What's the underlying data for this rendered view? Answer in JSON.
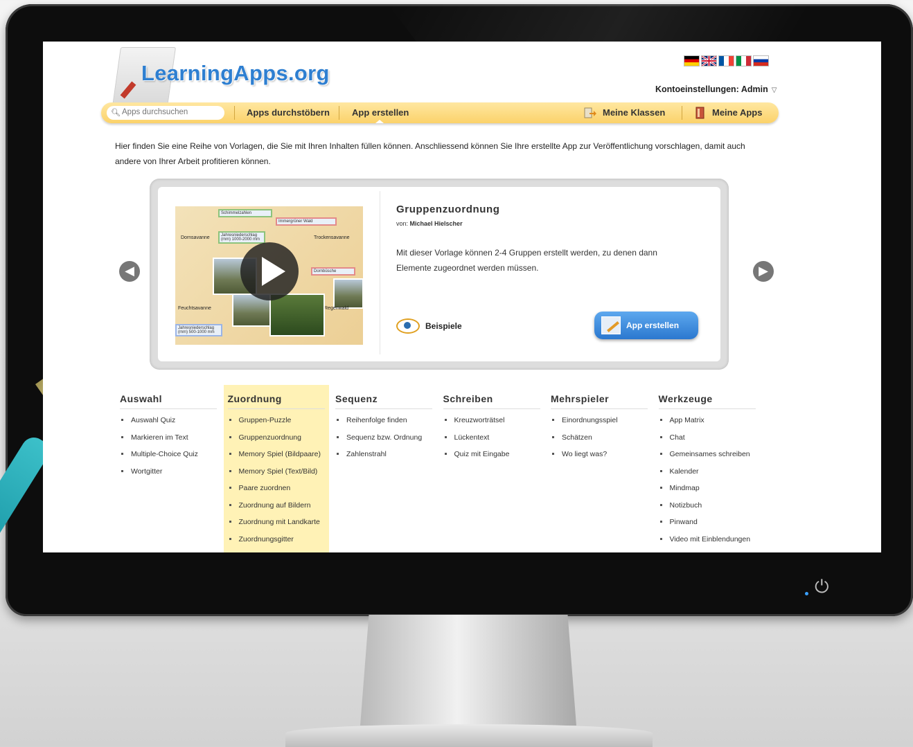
{
  "site": {
    "logo_text": "LearningApps.org",
    "account_label": "Kontoeinstellungen: Admin",
    "flags": [
      {
        "name": "german-flag",
        "colors": [
          "#000000",
          "#dd0000",
          "#ffce00"
        ]
      },
      {
        "name": "uk-flag",
        "colors": [
          "#012169",
          "#ffffff",
          "#c8102e"
        ]
      },
      {
        "name": "french-flag",
        "colors": [
          "#0055a4",
          "#ffffff",
          "#ef4135"
        ]
      },
      {
        "name": "italian-flag",
        "colors": [
          "#009246",
          "#ffffff",
          "#ce2b37"
        ]
      },
      {
        "name": "russian-flag",
        "colors": [
          "#ffffff",
          "#0039a6",
          "#d52b1e"
        ]
      }
    ]
  },
  "nav": {
    "search_placeholder": "Apps durchsuchen",
    "browse_label": "Apps durchstöbern",
    "create_label": "App erstellen",
    "classes_label": "Meine Klassen",
    "myapps_label": "Meine Apps"
  },
  "intro_text": "Hier finden Sie eine Reihe von Vorlagen, die Sie mit Ihren Inhalten füllen können. Anschliessend können Sie Ihre erstellte App zur Veröffentlichung vorschlagen, damit auch andere von Ihrer Arbeit profitieren können.",
  "featured": {
    "title": "Gruppenzuordnung",
    "author_prefix": "von:",
    "author": "Michael Hielscher",
    "description": "Mit dieser Vorlage können 2-4 Gruppen erstellt werden, zu denen dann Elemente zugeordnet werden müssen.",
    "examples_label": "Beispiele",
    "create_button": "App erstellen",
    "thumbnail": {
      "labels": [
        "Schimmelzahlen",
        "Immergrüner Wald",
        "Dornsavanne",
        "Jahresniederschlag (mm) 1000-2000 mm",
        "Trockensavanne",
        "Dornbüsche",
        "Feuchtsavanne",
        "Jahresniederschlag (mm) 500-1000 mm",
        "Regenwald"
      ]
    }
  },
  "categories": [
    {
      "title": "Auswahl",
      "highlighted": false,
      "items": [
        "Auswahl Quiz",
        "Markieren im Text",
        "Multiple-Choice Quiz",
        "Wortgitter"
      ]
    },
    {
      "title": "Zuordnung",
      "highlighted": true,
      "items": [
        "Gruppen-Puzzle",
        "Gruppenzuordnung",
        "Memory Spiel (Bildpaare)",
        "Memory Spiel (Text/Bild)",
        "Paare zuordnen",
        "Zuordnung auf Bildern",
        "Zuordnung mit Landkarte",
        "Zuordnungsgitter"
      ]
    },
    {
      "title": "Sequenz",
      "highlighted": false,
      "items": [
        "Reihenfolge finden",
        "Sequenz bzw. Ordnung",
        "Zahlenstrahl"
      ]
    },
    {
      "title": "Schreiben",
      "highlighted": false,
      "items": [
        "Kreuzworträtsel",
        "Lückentext",
        "Quiz mit Eingabe"
      ]
    },
    {
      "title": "Mehrspieler",
      "highlighted": false,
      "items": [
        "Einordnungsspiel",
        "Schätzen",
        "Wo liegt was?"
      ]
    },
    {
      "title": "Werkzeuge",
      "highlighted": false,
      "items": [
        "App Matrix",
        "Chat",
        "Gemeinsames schreiben",
        "Kalender",
        "Mindmap",
        "Notizbuch",
        "Pinwand",
        "Video mit Einblendungen"
      ]
    }
  ],
  "colors": {
    "navbar": "#fbd26a",
    "highlight": "#fff2b6",
    "logo": "#2e7fd1",
    "button": "#2b78cf"
  }
}
